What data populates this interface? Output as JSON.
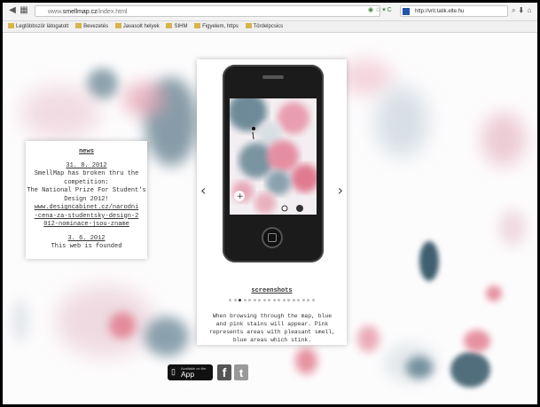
{
  "browser": {
    "url_prefix": "www.",
    "url_host": "smellmap.cz",
    "url_path": "/index.html",
    "search_text": "http://vrit.tatik.elte.hu",
    "bookmarks": [
      "Legtöbbször látogatott",
      "Bevezetés",
      "Javasolt helyek",
      "SIHM",
      "Figyelem, https",
      "Tördelpcsics"
    ]
  },
  "news": {
    "heading": "news",
    "date1": "31. 8. 2012",
    "text1": "SmellMap has broken thru the competition:",
    "text2": "The National Prize For Student's Design 2012!",
    "link1": "www.designcabinet.cz/narodni-cena-za-studentsky-design-2012-nominace-jsou-zname",
    "date2": "3. 6. 2012",
    "text3": "This web is founded"
  },
  "viewer": {
    "caption": "screenshots",
    "description": "When browsing through the map, blue and pink stains will appear. Pink represents areas with pleasant smell, blue areas which stink.",
    "dot_count": 18,
    "active_dot": 2
  },
  "footer": {
    "appstore_small": "Available on the",
    "appstore_big": "App Store",
    "facebook_letter": "f",
    "twitter_letter": "t"
  },
  "colors": {
    "blue_stain": "#3f5f6f",
    "pink_stain": "#e0788a"
  }
}
